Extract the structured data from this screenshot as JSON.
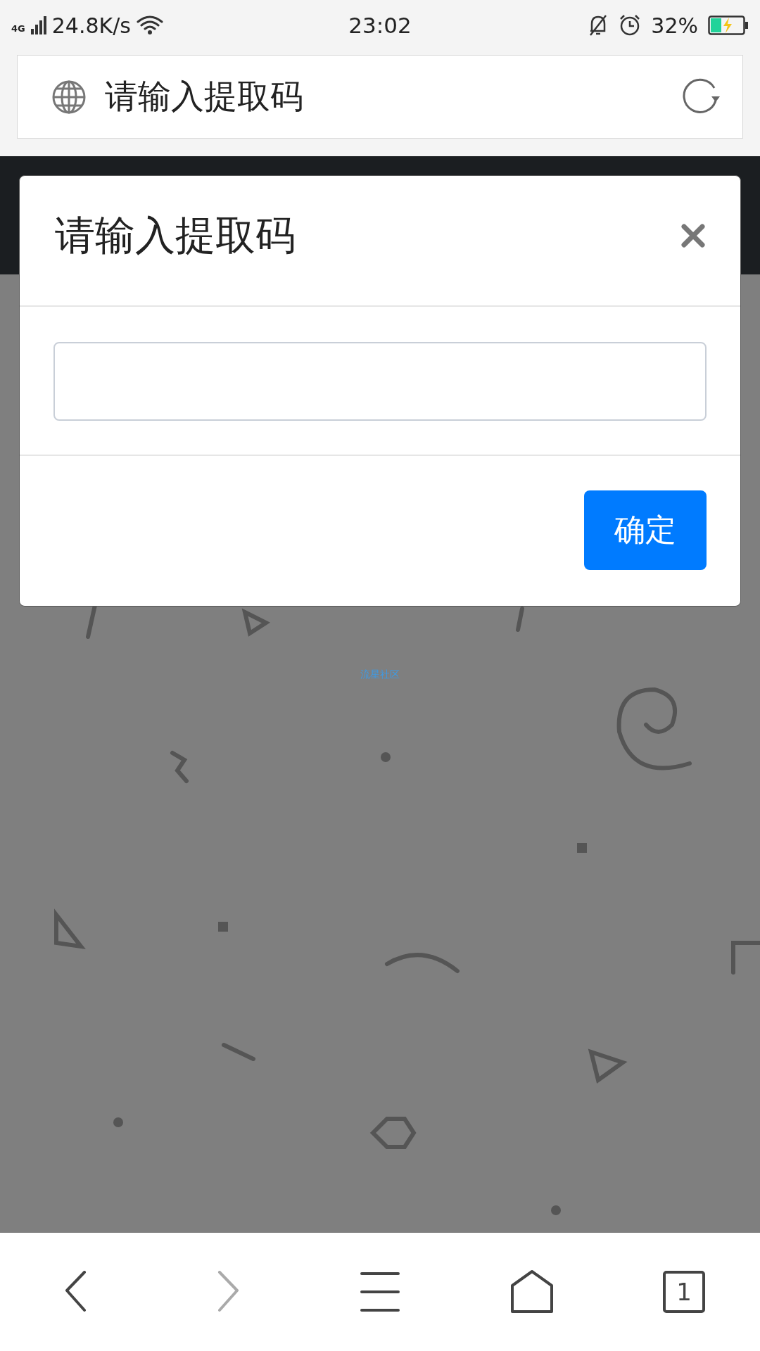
{
  "status_bar": {
    "network": "4G",
    "speed": "24.8K/s",
    "time": "23:02",
    "battery": "32%"
  },
  "address_bar": {
    "title": "请输入提取码"
  },
  "dialog": {
    "title": "请输入提取码",
    "button": "确定"
  },
  "page": {
    "footer_text": "流星社区"
  },
  "nav": [
    {
      "kind": "back",
      "disabled": false
    },
    {
      "kind": "forward",
      "disabled": true
    },
    {
      "kind": "menu",
      "disabled": false
    },
    {
      "kind": "home",
      "disabled": false
    },
    {
      "kind": "tabs",
      "disabled": false,
      "count": "1"
    }
  ]
}
